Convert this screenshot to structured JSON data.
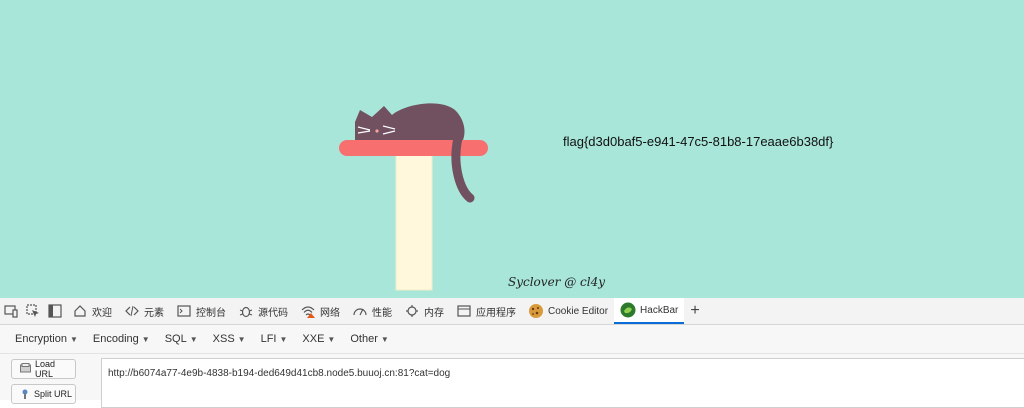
{
  "page": {
    "flag_text": "flag{d3d0baf5-e941-47c5-81b8-17eaae6b38df}",
    "credit": "Syclover @ cl4y"
  },
  "devtools": {
    "tabs": [
      {
        "label": "欢迎",
        "icon": "home-icon"
      },
      {
        "label": "元素",
        "icon": "code-icon"
      },
      {
        "label": "控制台",
        "icon": "console-icon"
      },
      {
        "label": "源代码",
        "icon": "bug-icon"
      },
      {
        "label": "网络",
        "icon": "wifi-icon"
      },
      {
        "label": "性能",
        "icon": "performance-icon"
      },
      {
        "label": "内存",
        "icon": "memory-icon"
      },
      {
        "label": "应用程序",
        "icon": "application-icon"
      },
      {
        "label": "Cookie Editor",
        "icon": "cookie-icon"
      },
      {
        "label": "HackBar",
        "icon": "hackbar-icon"
      }
    ],
    "active_tab": "HackBar"
  },
  "hackbar": {
    "menus": [
      "Encryption",
      "Encoding",
      "SQL",
      "XSS",
      "LFI",
      "XXE",
      "Other"
    ],
    "load_url_label": "Load URL",
    "split_url_label": "Split URL",
    "url_value": "http://b6074a77-4e9b-4838-b194-ded649d41cb8.node5.buuoj.cn:81?cat=dog"
  },
  "colors": {
    "background": "#a8e6da",
    "cat": "#71505f",
    "shelf": "#f76f6f",
    "post": "#fff8dc",
    "accent": "#0a6cd6"
  }
}
